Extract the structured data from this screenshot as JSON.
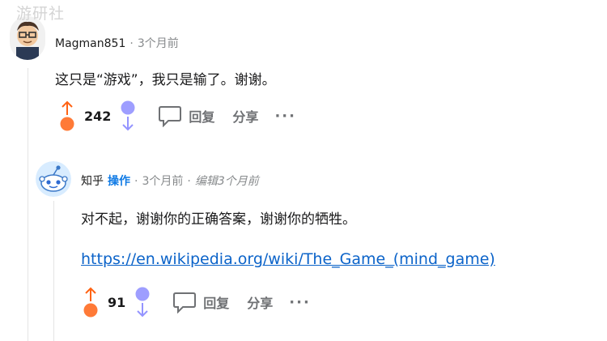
{
  "watermark": "游研社",
  "comments": [
    {
      "username": "Magman851",
      "separator": "·",
      "time": "3个月前",
      "body": "这只是“游戏”，我只是输了。谢谢。",
      "score": "242",
      "reply_label": "回复",
      "share_label": "分享",
      "more_label": "···",
      "colors": {
        "upvote": "#ff6314",
        "downvote": "#9494ff"
      }
    },
    {
      "username": "知乎",
      "role": "操作",
      "separator": "·",
      "time": "3个月前",
      "separator2": "·",
      "edited": "编辑3个月前",
      "body": "对不起，谢谢你的正确答案，谢谢你的牺牲。",
      "link": "https://en.wikipedia.org/wiki/The_Game_(mind_game)",
      "score": "91",
      "reply_label": "回复",
      "share_label": "分享",
      "more_label": "···",
      "colors": {
        "upvote": "#ff6314",
        "downvote": "#9494ff"
      }
    }
  ],
  "icons": {
    "upvote": "arrow-up-icon",
    "downvote": "arrow-down-icon",
    "reply": "speech-bubble-icon",
    "more": "more-dots-icon"
  }
}
